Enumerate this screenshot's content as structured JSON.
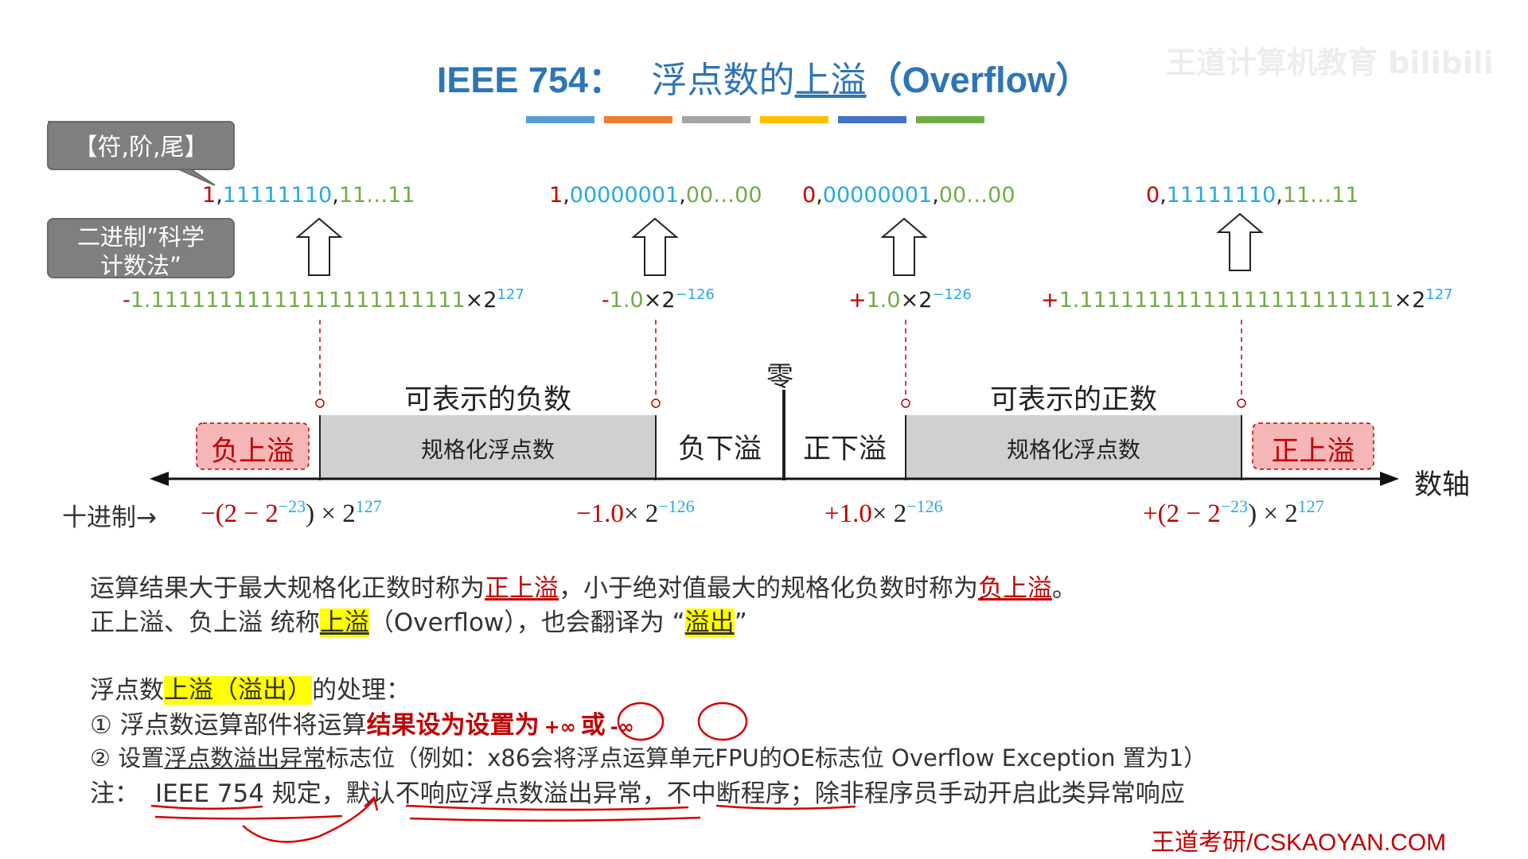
{
  "title": {
    "prefix": "IEEE 754：",
    "main_before": "浮点数的",
    "main_underlined": "上溢",
    "main_after": "（Overflow）"
  },
  "watermark": "王道计算机教育 bilibili",
  "callouts": {
    "fields": "【符,阶,尾】",
    "sci_line1": "二进制”科学",
    "sci_line2": "计数法”"
  },
  "encodings": [
    {
      "sign": "1",
      "exp": "11111110",
      "frac": "11…11"
    },
    {
      "sign": "1",
      "exp": "00000001",
      "frac": "00…00"
    },
    {
      "sign": "0",
      "exp": "00000001",
      "frac": "00…00"
    },
    {
      "sign": "0",
      "exp": "11111110",
      "frac": "11…11"
    }
  ],
  "binary_values": [
    {
      "sign": "-",
      "mantissa": "1.11111111111111111111111",
      "times": "×2",
      "exp": "127"
    },
    {
      "sign": "-",
      "mantissa": "1.0",
      "times": "×2",
      "exp": "−126"
    },
    {
      "sign": "+",
      "mantissa": "1.0",
      "times": "×2",
      "exp": "−126"
    },
    {
      "sign": "+",
      "mantissa": "1.11111111111111111111111",
      "times": "×2",
      "exp": "127"
    }
  ],
  "axis": {
    "zero": "零",
    "neg_label": "可表示的负数",
    "pos_label": "可表示的正数",
    "neg_norm": "规格化浮点数",
    "pos_norm": "规格化浮点数",
    "neg_overflow": "负上溢",
    "neg_underflow": "负下溢",
    "pos_underflow": "正下溢",
    "pos_overflow": "正上溢",
    "axis_name": "数轴"
  },
  "decimal": {
    "label": "十进制→",
    "v1": {
      "a": "−(2 − 2",
      "e1": "−23",
      "b": ") × 2",
      "e2": "127"
    },
    "v2": {
      "a": "−1.0",
      "b": "× 2",
      "e2": "−126"
    },
    "v3": {
      "a": "+1.0",
      "b": "× 2",
      "e2": "−126"
    },
    "v4": {
      "a": "+(2 − 2",
      "e1": "−23",
      "b": ") × 2",
      "e2": "127"
    }
  },
  "body": {
    "p1_a": "运算结果大于最大规格化正数时称为",
    "p1_b": "正上溢",
    "p1_c": "，小于绝对值最大的规格化负数时称为",
    "p1_d": "负上溢",
    "p1_e": "。",
    "p2_a": "正上溢、负上溢 统称",
    "p2_b": "上溢",
    "p2_c": "（Overflow），也会翻译为 “",
    "p2_d": "溢出",
    "p2_e": "”",
    "p3_a": "浮点数",
    "p3_b": "上溢（溢出）",
    "p3_c": "的处理：",
    "p4_a": "① 浮点数运算部件将运算",
    "p4_b": "结果设为设置为",
    "p4_c": "+∞",
    "p4_d": "或",
    "p4_e": "-∞",
    "p5_a": "② 设置",
    "p5_b": "浮点数溢出异常",
    "p5_c": "标志位（例如：x86会将浮点运算单元FPU的OE标志位 Overflow Exception 置为1）",
    "p6_a": "注：",
    "p6_b": "IEEE 754",
    "p6_c": " 规定，默认",
    "p6_d": "不响应浮点数溢出异常",
    "p6_e": "，",
    "p6_f": "不中断程序",
    "p6_g": "；除非程序员手动开启此类异常响应"
  },
  "footer": "王道考研/CSKAOYAN.COM",
  "colors": {
    "title": "#2e75b6",
    "red": "#c00000",
    "cyan": "#1fa3dc",
    "green": "#70ad47",
    "gray_box": "#d0d0d0",
    "overflow_box": "#f4b6b6",
    "callout": "#7f7f7f"
  }
}
